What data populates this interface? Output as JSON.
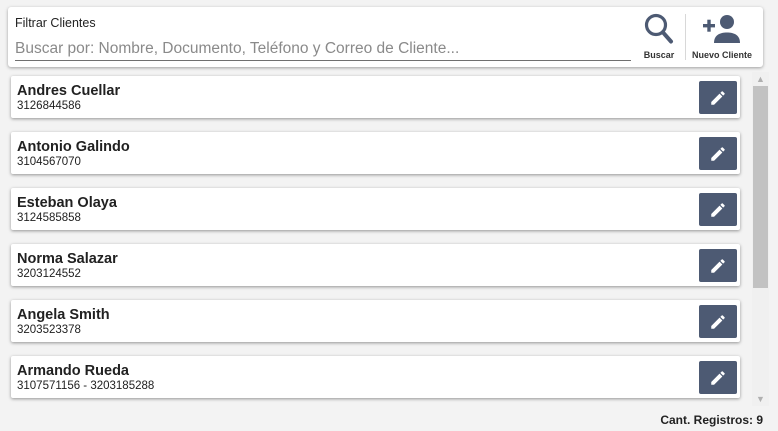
{
  "filter": {
    "label": "Filtrar Clientes",
    "search_placeholder": "Buscar por: Nombre, Documento, Teléfono y Correo de Cliente...",
    "search_value": "",
    "search_button_label": "Buscar",
    "new_client_button_label": "Nuevo Cliente",
    "search_icon": "search-icon",
    "new_client_icon": "add-person-icon"
  },
  "clients": [
    {
      "name": "Andres Cuellar",
      "phone": "3126844586"
    },
    {
      "name": "Antonio Galindo",
      "phone": "3104567070"
    },
    {
      "name": "Esteban Olaya",
      "phone": "3124585858"
    },
    {
      "name": "Norma Salazar",
      "phone": "3203124552"
    },
    {
      "name": "Angela Smith",
      "phone": "3203523378"
    },
    {
      "name": "Armando Rueda",
      "phone": "3107571156 - 3203185288"
    }
  ],
  "edit_icon": "pencil-icon",
  "footer": {
    "count_text": "Cant. Registros: 9"
  },
  "colors": {
    "edit_button": "#4d5a73",
    "background": "#f3f3f3",
    "card": "#ffffff"
  }
}
